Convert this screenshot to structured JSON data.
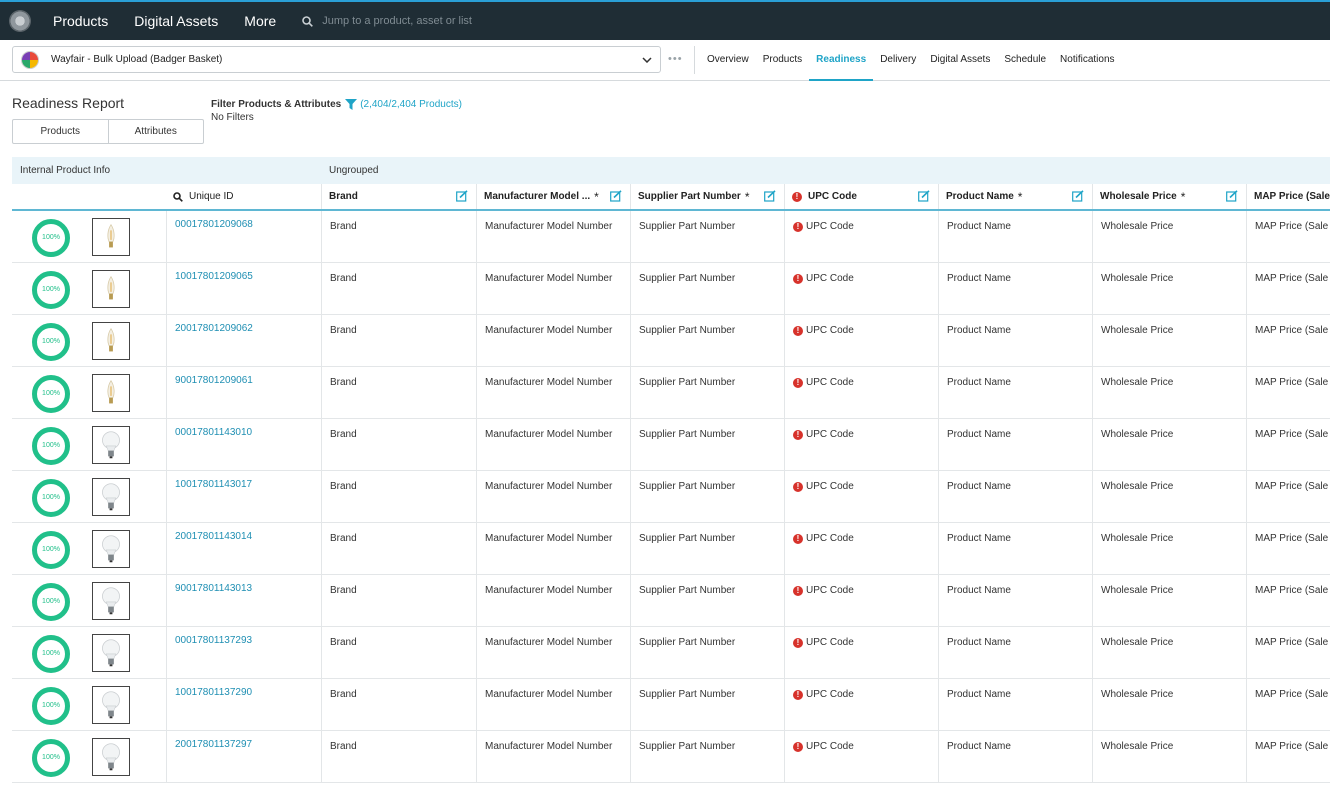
{
  "topnav": {
    "items": [
      "Products",
      "Digital Assets",
      "More"
    ],
    "search_placeholder": "Jump to a product, asset or list"
  },
  "subbar": {
    "channel": "Wayfair - Bulk Upload (Badger Basket)",
    "more": "•••",
    "tabs": [
      "Overview",
      "Products",
      "Readiness",
      "Delivery",
      "Digital Assets",
      "Schedule",
      "Notifications"
    ],
    "active_tab": "Readiness"
  },
  "report": {
    "title": "Readiness Report",
    "toggle": [
      "Products",
      "Attributes"
    ],
    "filter_title": "Filter Products & Attributes",
    "filter_count": "(2,404/2,404 Products)",
    "filter_sub": "No Filters"
  },
  "table": {
    "groups": [
      "Internal Product Info",
      "Ungrouped"
    ],
    "columns": {
      "unique_id": "Unique ID",
      "brand": "Brand",
      "mmn": "Manufacturer Model ...",
      "spn": "Supplier Part Number",
      "upc": "UPC Code",
      "pname": "Product Name",
      "wprice": "Wholesale Price",
      "map": "MAP Price (Sale"
    },
    "rows": [
      {
        "pct": "100%",
        "img": "filament",
        "id": "00017801209068",
        "brand": "Brand",
        "mmn": "Manufacturer Model Number",
        "spn": "Supplier Part Number",
        "upc": "UPC Code",
        "pname": "Product Name",
        "wprice": "Wholesale Price",
        "map": "MAP Price (Sale"
      },
      {
        "pct": "100%",
        "img": "filament",
        "id": "10017801209065",
        "brand": "Brand",
        "mmn": "Manufacturer Model Number",
        "spn": "Supplier Part Number",
        "upc": "UPC Code",
        "pname": "Product Name",
        "wprice": "Wholesale Price",
        "map": "MAP Price (Sale"
      },
      {
        "pct": "100%",
        "img": "filament",
        "id": "20017801209062",
        "brand": "Brand",
        "mmn": "Manufacturer Model Number",
        "spn": "Supplier Part Number",
        "upc": "UPC Code",
        "pname": "Product Name",
        "wprice": "Wholesale Price",
        "map": "MAP Price (Sale"
      },
      {
        "pct": "100%",
        "img": "filament",
        "id": "90017801209061",
        "brand": "Brand",
        "mmn": "Manufacturer Model Number",
        "spn": "Supplier Part Number",
        "upc": "UPC Code",
        "pname": "Product Name",
        "wprice": "Wholesale Price",
        "map": "MAP Price (Sale"
      },
      {
        "pct": "100%",
        "img": "bulb",
        "id": "00017801143010",
        "brand": "Brand",
        "mmn": "Manufacturer Model Number",
        "spn": "Supplier Part Number",
        "upc": "UPC Code",
        "pname": "Product Name",
        "wprice": "Wholesale Price",
        "map": "MAP Price (Sale"
      },
      {
        "pct": "100%",
        "img": "bulb",
        "id": "10017801143017",
        "brand": "Brand",
        "mmn": "Manufacturer Model Number",
        "spn": "Supplier Part Number",
        "upc": "UPC Code",
        "pname": "Product Name",
        "wprice": "Wholesale Price",
        "map": "MAP Price (Sale"
      },
      {
        "pct": "100%",
        "img": "bulb",
        "id": "20017801143014",
        "brand": "Brand",
        "mmn": "Manufacturer Model Number",
        "spn": "Supplier Part Number",
        "upc": "UPC Code",
        "pname": "Product Name",
        "wprice": "Wholesale Price",
        "map": "MAP Price (Sale"
      },
      {
        "pct": "100%",
        "img": "bulb",
        "id": "90017801143013",
        "brand": "Brand",
        "mmn": "Manufacturer Model Number",
        "spn": "Supplier Part Number",
        "upc": "UPC Code",
        "pname": "Product Name",
        "wprice": "Wholesale Price",
        "map": "MAP Price (Sale"
      },
      {
        "pct": "100%",
        "img": "bulb",
        "id": "00017801137293",
        "brand": "Brand",
        "mmn": "Manufacturer Model Number",
        "spn": "Supplier Part Number",
        "upc": "UPC Code",
        "pname": "Product Name",
        "wprice": "Wholesale Price",
        "map": "MAP Price (Sale"
      },
      {
        "pct": "100%",
        "img": "bulb",
        "id": "10017801137290",
        "brand": "Brand",
        "mmn": "Manufacturer Model Number",
        "spn": "Supplier Part Number",
        "upc": "UPC Code",
        "pname": "Product Name",
        "wprice": "Wholesale Price",
        "map": "MAP Price (Sale"
      },
      {
        "pct": "100%",
        "img": "bulb",
        "id": "20017801137297",
        "brand": "Brand",
        "mmn": "Manufacturer Model Number",
        "spn": "Supplier Part Number",
        "upc": "UPC Code",
        "pname": "Product Name",
        "wprice": "Wholesale Price",
        "map": "MAP Price (Sale"
      }
    ]
  },
  "colors": {
    "accent": "#1fa4c7",
    "ring": "#21c08a",
    "error": "#d7322b",
    "topbar": "#1f2d35"
  }
}
